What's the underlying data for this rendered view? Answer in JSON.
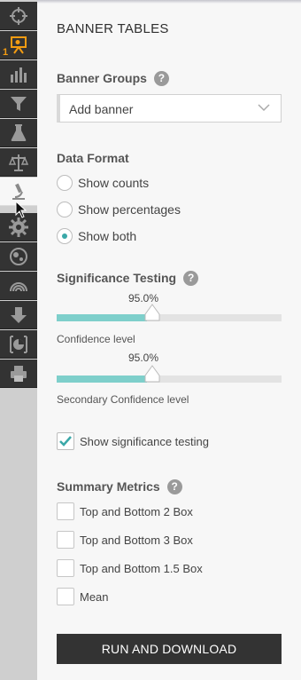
{
  "rail": {
    "badge": "1",
    "items": [
      {
        "icon": "crosshair-icon"
      },
      {
        "icon": "presentation-icon"
      },
      {
        "icon": "bar-chart-icon"
      },
      {
        "icon": "filter-icon"
      },
      {
        "icon": "flask-icon"
      },
      {
        "icon": "scale-icon"
      },
      {
        "icon": "microscope-icon"
      },
      {
        "icon": "gear-icon"
      },
      {
        "icon": "network-icon"
      },
      {
        "icon": "rainbow-icon"
      },
      {
        "icon": "download-icon"
      },
      {
        "icon": "pie-chart-icon"
      },
      {
        "icon": "printer-icon"
      }
    ],
    "active_index": 6
  },
  "panel": {
    "title": "BANNER TABLES",
    "banner_groups": {
      "label": "Banner Groups",
      "help": "?",
      "select_value": "Add banner"
    },
    "data_format": {
      "label": "Data Format",
      "options": [
        "Show counts",
        "Show percentages",
        "Show both"
      ],
      "selected": "Show both"
    },
    "significance": {
      "label": "Significance Testing",
      "help": "?",
      "confidence": {
        "value_text": "95.0%",
        "level": 0.4,
        "caption": "Confidence level"
      },
      "secondary": {
        "value_text": "95.0%",
        "level": 0.4,
        "caption": "Secondary Confidence level"
      },
      "show_label": "Show significance testing",
      "show_checked": true
    },
    "summary_metrics": {
      "label": "Summary Metrics",
      "help": "?",
      "items": [
        "Top and Bottom 2 Box",
        "Top and Bottom 3 Box",
        "Top and Bottom 1.5 Box",
        "Mean"
      ]
    },
    "run_button": "RUN AND DOWNLOAD"
  },
  "colors": {
    "accent": "#3aa8a8",
    "slider_fill": "#7ecfcb",
    "dark": "#333333",
    "badge": "#f39c12"
  }
}
